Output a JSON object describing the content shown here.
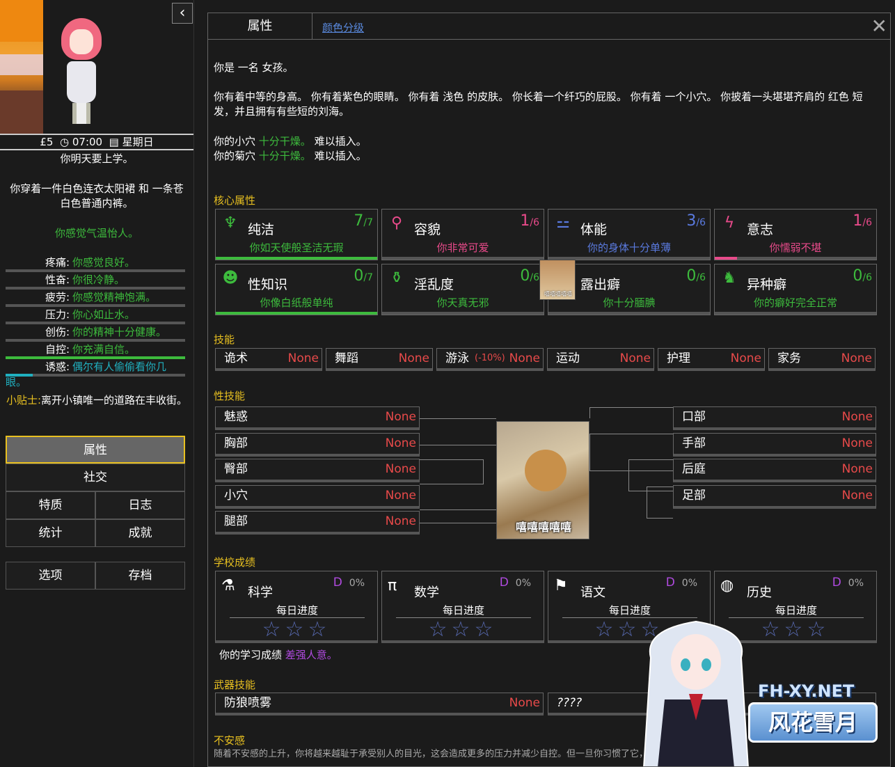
{
  "sidebar": {
    "money": "£5",
    "time": "07:00",
    "weekday": "星期日",
    "clock_icon": "clock-icon",
    "calendar_icon": "calendar-icon",
    "line1": "你明天要上学。",
    "line2": "你穿着一件白色连衣太阳裙 和 一条苍白色普通内裤。",
    "line3": "你感觉气温怡人。",
    "stats": [
      {
        "label": "疼痛:",
        "value": "你感觉良好。",
        "level": 0,
        "color": "#3dbb3d"
      },
      {
        "label": "性奋:",
        "value": "你很冷静。",
        "level": 0,
        "color": "#3dbb3d"
      },
      {
        "label": "疲劳:",
        "value": "你感觉精神饱满。",
        "level": 0,
        "color": "#3dbb3d"
      },
      {
        "label": "压力:",
        "value": "你心如止水。",
        "level": 0,
        "color": "#3dbb3d"
      },
      {
        "label": "创伤:",
        "value": "你的精神十分健康。",
        "level": 0,
        "color": "#3dbb3d"
      },
      {
        "label": "自控:",
        "value": "你充满自信。",
        "level": 1,
        "color": "#3dbb3d"
      },
      {
        "label": "诱惑:",
        "value": "偶尔有人偷偷看你几眼。",
        "level": 0.15,
        "color": "#20b0c0"
      }
    ],
    "tip_label": "小贴士:",
    "tip_text": "离开小镇唯一的道路在丰收街。",
    "menu": {
      "attributes": "属性",
      "social": "社交",
      "traits": "特质",
      "journal": "日志",
      "statistics": "统计",
      "achievements": "成就",
      "options": "选项",
      "saves": "存档"
    }
  },
  "main": {
    "tab_attributes": "属性",
    "tab_color": "颜色分级",
    "desc1": "你是 一名 女孩。",
    "desc2": "你有着中等的身高。 你有着紫色的眼睛。 你有着 浅色 的皮肤。 你长着一个纤巧的屁股。 你有着 一个小穴。 你披着一头堪堪齐肩的 红色 短发，并且拥有有些短的刘海。",
    "desc3a": "你的小穴",
    "desc3b": "十分干燥。",
    "desc3c": "难以插入。",
    "desc4a": "你的菊穴",
    "desc4b": "十分干燥。",
    "desc4c": "难以插入。",
    "core_title": "核心属性",
    "core": [
      {
        "name": "纯洁",
        "score": "7",
        "max": "/7",
        "desc": "你如天使般圣洁无瑕",
        "color": "#3dbb3d",
        "level": 1,
        "icon": "halo-wings-icon",
        "glyph": "♆"
      },
      {
        "name": "容貌",
        "score": "1",
        "max": "/6",
        "desc": "你非常可爱",
        "color": "#e84a8a",
        "level": 0,
        "icon": "magnifier-icon",
        "glyph": "⚲"
      },
      {
        "name": "体能",
        "score": "3",
        "max": "/6",
        "desc": "你的身体十分单薄",
        "color": "#5a7adf",
        "level": 0,
        "icon": "dumbbell-icon",
        "glyph": "⚍"
      },
      {
        "name": "意志",
        "score": "1",
        "max": "/6",
        "desc": "你懦弱不堪",
        "color": "#e84a8a",
        "level": 0.14,
        "icon": "lightning-icon",
        "glyph": "ϟ"
      },
      {
        "name": "性知识",
        "score": "0",
        "max": "/7",
        "desc": "你像白纸般单纯",
        "color": "#3dbb3d",
        "level": 1,
        "icon": "girl-face-icon",
        "glyph": "☻"
      },
      {
        "name": "淫乱度",
        "score": "0",
        "max": "/6",
        "desc": "你天真无邪",
        "color": "#3dbb3d",
        "level": 0,
        "icon": "potion-jar-icon",
        "glyph": "⚱"
      },
      {
        "name": "露出癖",
        "score": "0",
        "max": "/6",
        "desc": "你十分腼腆",
        "color": "#3dbb3d",
        "level": 0,
        "icon": "doge-icon",
        "glyph": ""
      },
      {
        "name": "异种癖",
        "score": "0",
        "max": "/6",
        "desc": "你的癖好完全正常",
        "color": "#3dbb3d",
        "level": 0,
        "icon": "dog-icon",
        "glyph": "♞"
      }
    ],
    "doge_small_caption": "嘻嘻嘻嘻嘻",
    "skills_title": "技能",
    "skills": [
      {
        "name": "诡术",
        "value": "None"
      },
      {
        "name": "舞蹈",
        "value": "None"
      },
      {
        "name": "游泳",
        "mod": "(-10%)",
        "value": "None"
      },
      {
        "name": "运动",
        "value": "None"
      },
      {
        "name": "护理",
        "value": "None"
      },
      {
        "name": "家务",
        "value": "None"
      }
    ],
    "sex_title": "性技能",
    "sex_left": [
      {
        "name": "魅惑",
        "value": "None"
      },
      {
        "name": "胸部",
        "value": "None"
      },
      {
        "name": "臀部",
        "value": "None"
      },
      {
        "name": "小穴",
        "value": "None"
      },
      {
        "name": "腿部",
        "value": "None"
      }
    ],
    "sex_right": [
      {
        "name": "口部",
        "value": "None"
      },
      {
        "name": "手部",
        "value": "None"
      },
      {
        "name": "后庭",
        "value": "None"
      },
      {
        "name": "足部",
        "value": "None"
      }
    ],
    "doge_caption": "嘻嘻嘻嘻嘻",
    "school_title": "学校成绩",
    "school": [
      {
        "name": "科学",
        "grade": "D",
        "pct": "0%",
        "progress": "每日进度",
        "icon": "flask-icon",
        "glyph": "⚗"
      },
      {
        "name": "数学",
        "grade": "D",
        "pct": "0%",
        "progress": "每日进度",
        "icon": "pi-icon",
        "glyph": "π"
      },
      {
        "name": "语文",
        "grade": "D",
        "pct": "0%",
        "progress": "每日进度",
        "icon": "uk-flag-icon",
        "glyph": "⚑"
      },
      {
        "name": "历史",
        "grade": "D",
        "pct": "0%",
        "progress": "每日进度",
        "icon": "globe-icon",
        "glyph": "◍"
      }
    ],
    "stars": "☆☆☆",
    "school_summary_a": "你的学习成绩",
    "school_summary_b": "差强人意。",
    "weapon_title": "武器技能",
    "weapon": {
      "name": "防狼喷雾",
      "value": "None"
    },
    "weapon_unknown": "????",
    "insecurity_title": "不安感",
    "insecurity_text": "随着不安感的上升，你将越来越耻于承受别人的目光，这会造成更多的压力并减少自控。但一旦你习惯了它，这种影响将会被消除。"
  },
  "watermark": {
    "site": "FH-XY.NET",
    "brand": "风花雪月"
  }
}
